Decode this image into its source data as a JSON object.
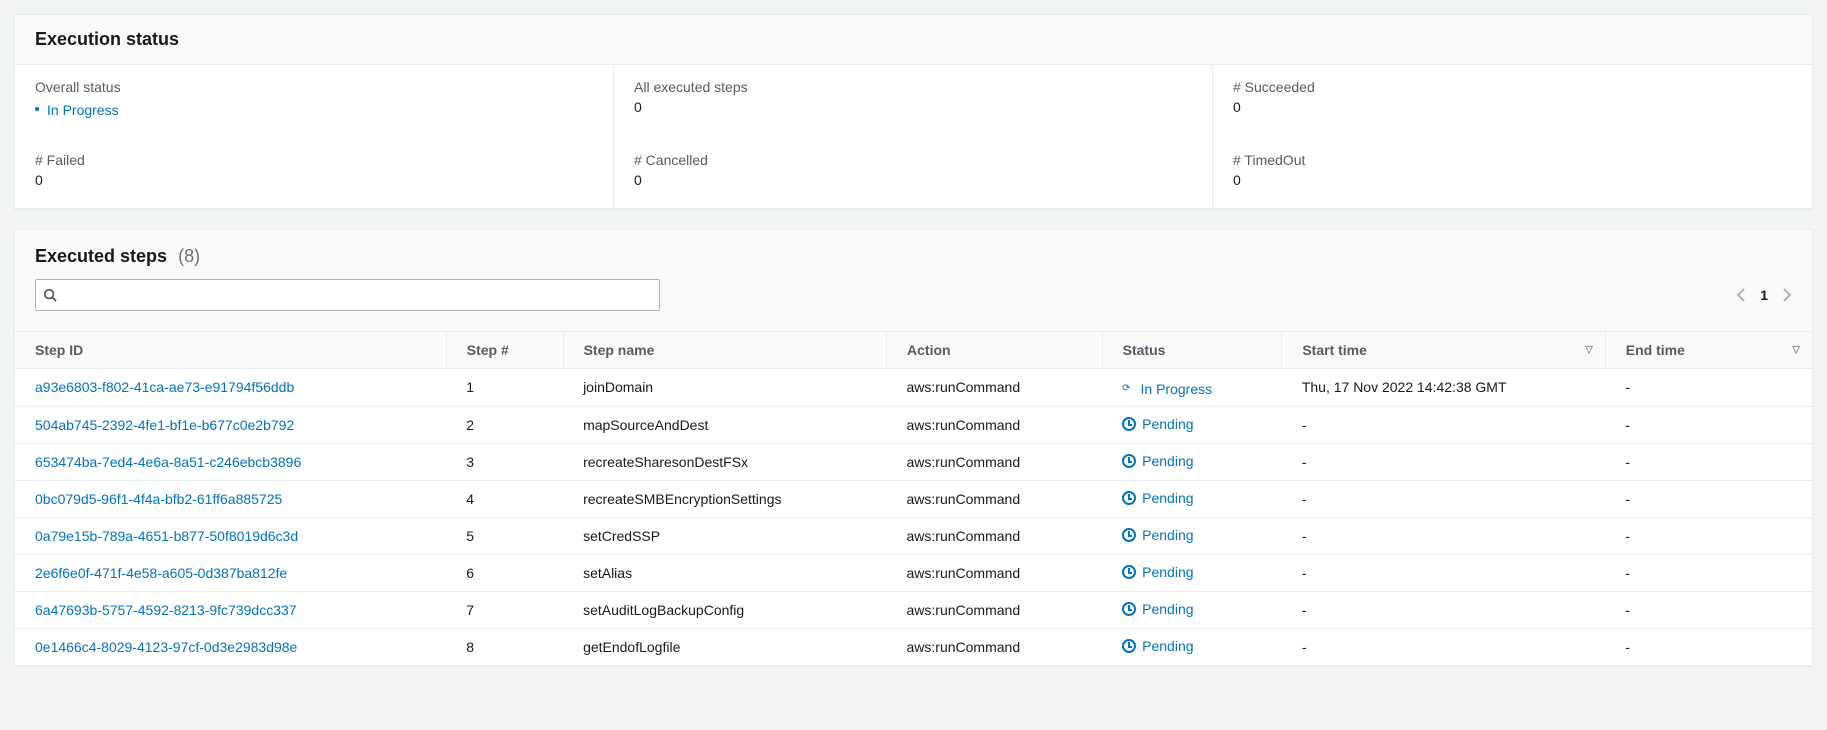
{
  "execution_status": {
    "title": "Execution status",
    "cells": {
      "overall_label": "Overall status",
      "overall_value": "In Progress",
      "all_steps_label": "All executed steps",
      "all_steps_value": "0",
      "succeeded_label": "# Succeeded",
      "succeeded_value": "0",
      "failed_label": "# Failed",
      "failed_value": "0",
      "cancelled_label": "# Cancelled",
      "cancelled_value": "0",
      "timedout_label": "# TimedOut",
      "timedout_value": "0"
    }
  },
  "executed_steps": {
    "title": "Executed steps",
    "count": "(8)",
    "page": "1",
    "columns": {
      "step_id": "Step ID",
      "step_num": "Step #",
      "step_name": "Step name",
      "action": "Action",
      "status": "Status",
      "start_time": "Start time",
      "end_time": "End time"
    },
    "status_labels": {
      "in_progress": "In Progress",
      "pending": "Pending"
    },
    "rows": [
      {
        "id": "a93e6803-f802-41ca-ae73-e91794f56ddb",
        "num": "1",
        "name": "joinDomain",
        "action": "aws:runCommand",
        "status": "in_progress",
        "start": "Thu, 17 Nov 2022 14:42:38 GMT",
        "end": "-"
      },
      {
        "id": "504ab745-2392-4fe1-bf1e-b677c0e2b792",
        "num": "2",
        "name": "mapSourceAndDest",
        "action": "aws:runCommand",
        "status": "pending",
        "start": "-",
        "end": "-"
      },
      {
        "id": "653474ba-7ed4-4e6a-8a51-c246ebcb3896",
        "num": "3",
        "name": "recreateSharesonDestFSx",
        "action": "aws:runCommand",
        "status": "pending",
        "start": "-",
        "end": "-"
      },
      {
        "id": "0bc079d5-96f1-4f4a-bfb2-61ff6a885725",
        "num": "4",
        "name": "recreateSMBEncryptionSettings",
        "action": "aws:runCommand",
        "status": "pending",
        "start": "-",
        "end": "-"
      },
      {
        "id": "0a79e15b-789a-4651-b877-50f8019d6c3d",
        "num": "5",
        "name": "setCredSSP",
        "action": "aws:runCommand",
        "status": "pending",
        "start": "-",
        "end": "-"
      },
      {
        "id": "2e6f6e0f-471f-4e58-a605-0d387ba812fe",
        "num": "6",
        "name": "setAlias",
        "action": "aws:runCommand",
        "status": "pending",
        "start": "-",
        "end": "-"
      },
      {
        "id": "6a47693b-5757-4592-8213-9fc739dcc337",
        "num": "7",
        "name": "setAuditLogBackupConfig",
        "action": "aws:runCommand",
        "status": "pending",
        "start": "-",
        "end": "-"
      },
      {
        "id": "0e1466c4-8029-4123-97cf-0d3e2983d98e",
        "num": "8",
        "name": "getEndofLogfile",
        "action": "aws:runCommand",
        "status": "pending",
        "start": "-",
        "end": "-"
      }
    ]
  }
}
